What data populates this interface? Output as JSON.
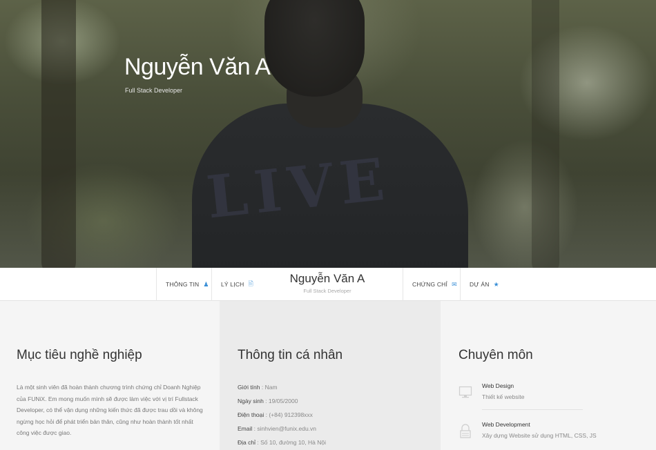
{
  "hero": {
    "name": "Nguyễn Văn A",
    "title": "Full Stack Developer"
  },
  "nav": {
    "items": [
      {
        "label": "THÔNG TIN",
        "icon": "user-icon"
      },
      {
        "label": "LÝ LỊCH",
        "icon": "document-icon"
      },
      {
        "label": "CHỨNG CHỈ",
        "icon": "envelope-icon"
      },
      {
        "label": "DỰ ÁN",
        "icon": "star-icon"
      }
    ],
    "brand_name": "Nguyễn Văn A",
    "brand_subtitle": "Full Stack Developer"
  },
  "objective": {
    "heading": "Mục tiêu nghề nghiệp",
    "text": "Là một sinh viên đã hoàn thành chương trình chứng chỉ Doanh Nghiệp của FUNiX. Em mong muốn mình sẽ được làm việc với vị trí Fullstack Developer, có thể vận dụng những kiến thức đã được trau dồi và không ngừng học hỏi để phát triển bản thân, cũng như hoàn thành tốt nhất công việc được giao."
  },
  "personal": {
    "heading": "Thông tin cá nhân",
    "rows": [
      {
        "key": "Giới tính",
        "value": "Nam"
      },
      {
        "key": "Ngày sinh",
        "value": "19/05/2000"
      },
      {
        "key": "Điện thoại",
        "value": "(+84) 912398xxx"
      },
      {
        "key": "Email",
        "value": "sinhvien@funix.edu.vn"
      },
      {
        "key": "Địa chỉ",
        "value": "Số 10, đường 10, Hà Nội"
      }
    ]
  },
  "skills": {
    "heading": "Chuyên môn",
    "items": [
      {
        "title": "Web Design",
        "desc": "Thiết kế website",
        "icon": "monitor-icon"
      },
      {
        "title": "Web Development",
        "desc": "Xây dựng Website sử dụng HTML, CSS, JS",
        "icon": "lock-icon"
      }
    ]
  },
  "colors": {
    "accent": "#3a8fd6",
    "nav_bg": "#ffffff",
    "col_light": "#f5f5f5",
    "col_mid": "#ebebeb"
  }
}
